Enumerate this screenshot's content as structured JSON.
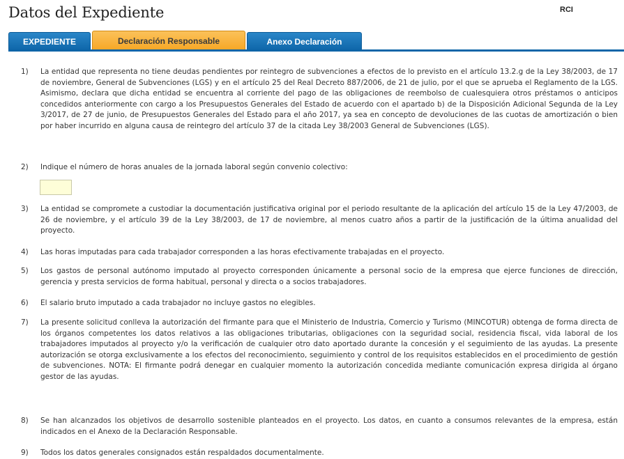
{
  "header": {
    "title": "Datos del Expediente",
    "badge": "RCI"
  },
  "tabs": [
    {
      "label": "EXPEDIENTE",
      "active": false
    },
    {
      "label": "Declaración Responsable",
      "active": true
    },
    {
      "label": "Anexo Declaración",
      "active": false
    }
  ],
  "colors": {
    "tab_blue": "#0d65a8",
    "tab_active": "#f6a623",
    "input_bg": "#fefed8"
  },
  "items": [
    {
      "num": "1)",
      "text": "La entidad que representa no tiene deudas pendientes por reintegro de subvenciones a efectos de lo previsto en el artículo 13.2.g de la Ley 38/2003, de 17 de noviembre, General de Subvenciones (LGS) y en el artículo 25 del Real Decreto 887/2006, de 21 de julio, por el que se aprueba el Reglamento de la LGS. Asimismo, declara que dicha entidad se encuentra al corriente del pago de las obligaciones de reembolso de cualesquiera otros préstamos o anticipos concedidos anteriormente con cargo a los Presupuestos Generales del Estado de acuerdo con el apartado b) de la Disposición Adicional Segunda de la Ley 3/2017, de 27 de junio, de Presupuestos Generales del Estado para el año 2017, ya sea en concepto de devoluciones de las cuotas de amortización o bien por haber incurrido en alguna causa de reintegro del artículo 37 de la citada Ley 38/2003 General de Subvenciones (LGS)."
    },
    {
      "num": "2)",
      "text": "Indique el número de horas anuales de la jornada laboral según convenio colectivo:"
    },
    {
      "num": "3)",
      "text": "La entidad se compromete a custodiar la documentación justificativa original por el periodo resultante de la aplicación del artículo 15 de la Ley 47/2003, de 26 de noviembre, y el artículo 39 de la Ley 38/2003, de 17 de noviembre, al menos cuatro años a partir de la justificación de la última anualidad del proyecto."
    },
    {
      "num": "4)",
      "text": "Las horas imputadas para cada trabajador corresponden a las horas efectivamente trabajadas en el proyecto."
    },
    {
      "num": "5)",
      "text": "Los gastos de personal autónomo imputado al proyecto corresponden únicamente a personal socio de la empresa que ejerce funciones de dirección, gerencia y presta servicios de forma habitual, personal y directa o a socios trabajadores."
    },
    {
      "num": "6)",
      "text": "El salario bruto imputado a cada trabajador no incluye gastos no elegibles."
    },
    {
      "num": "7)",
      "text": "La presente solicitud conlleva la autorización del firmante para que el Ministerio de Industria, Comercio y Turismo (MINCOTUR) obtenga de forma directa de los órganos competentes los datos relativos a las obligaciones tributarias, obligaciones con la seguridad social, residencia fiscal, vida laboral de los trabajadores imputados al proyecto y/o la verificación de cualquier otro dato aportado durante la concesión y el seguimiento de las ayudas. La presente autorización se otorga exclusivamente a los efectos del reconocimiento, seguimiento y control de los requisitos establecidos en el procedimiento de gestión de subvenciones. NOTA: El firmante podrá denegar en cualquier momento la autorización concedida mediante comunicación expresa dirigida al órgano gestor de las ayudas."
    },
    {
      "num": "8)",
      "text": "Se han alcanzados los objetivos de desarrollo sostenible planteados en el proyecto. Los datos, en cuanto a consumos relevantes de la empresa, están indicados en el Anexo de la Declaración Responsable."
    },
    {
      "num": "9)",
      "text": "Todos los datos generales consignados están respaldados documentalmente."
    }
  ],
  "hours_input": {
    "value": "",
    "placeholder": ""
  }
}
